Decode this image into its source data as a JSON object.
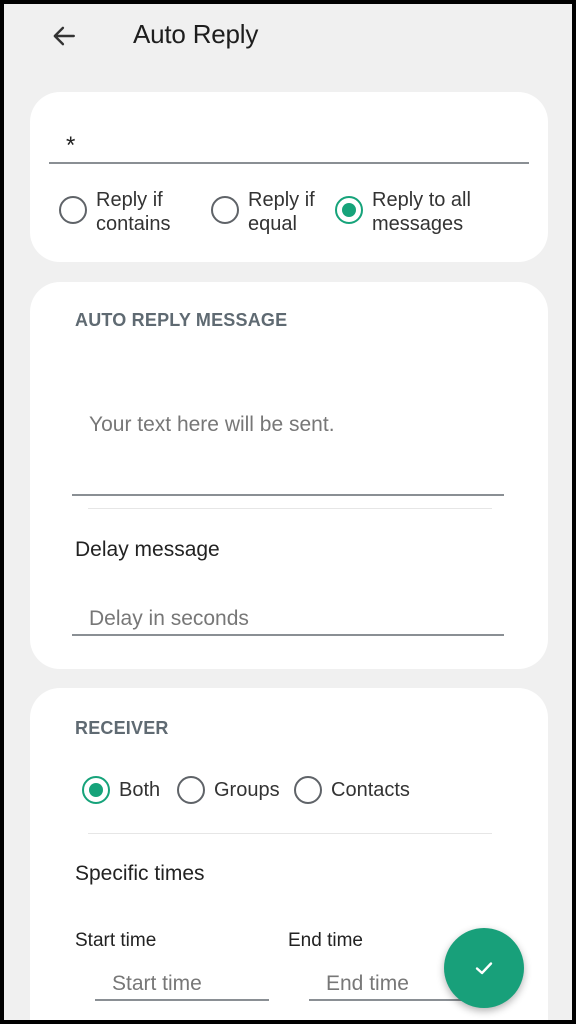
{
  "header": {
    "title": "Auto Reply",
    "back_icon": "arrow-left-icon"
  },
  "keyword": {
    "value": "*",
    "options": [
      {
        "label": "Reply if contains",
        "line1": "Reply if",
        "line2": "contains",
        "selected": false
      },
      {
        "label": "Reply if equal",
        "line1": "Reply if",
        "line2": "equal",
        "selected": false
      },
      {
        "label": "Reply to all messages",
        "line1": "Reply to all",
        "line2": "messages",
        "selected": true
      }
    ]
  },
  "message": {
    "section_title": "AUTO REPLY MESSAGE",
    "placeholder": "Your text here will be sent.",
    "delay_label": "Delay message",
    "delay_placeholder": "Delay in seconds"
  },
  "receiver": {
    "section_title": "RECEIVER",
    "options": [
      {
        "label": "Both",
        "selected": true
      },
      {
        "label": "Groups",
        "selected": false
      },
      {
        "label": "Contacts",
        "selected": false
      }
    ],
    "specific_times_label": "Specific times",
    "start_time_label": "Start time",
    "start_time_placeholder": "Start time",
    "end_time_label": "End time",
    "end_time_placeholder": "End time"
  },
  "fab": {
    "icon": "check-icon"
  },
  "colors": {
    "accent": "#16a37a",
    "background": "#f0f0f0",
    "card": "#ffffff"
  }
}
